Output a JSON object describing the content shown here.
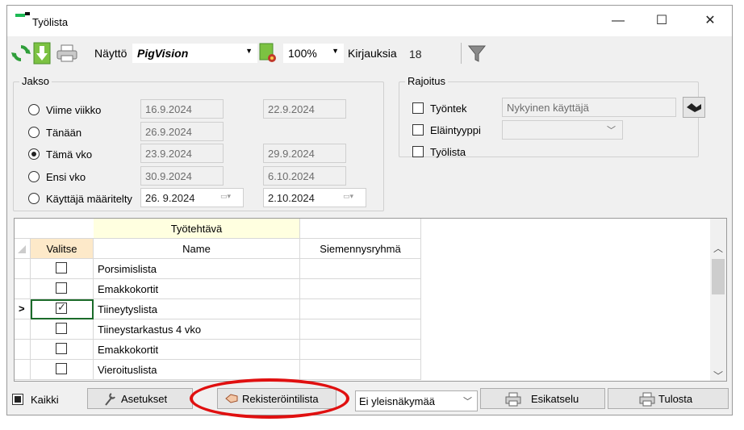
{
  "window": {
    "title": "Työlista",
    "minimize_glyph": "—",
    "maximize_glyph": "☐",
    "close_glyph": "✕"
  },
  "toolbar": {
    "nayto_label": "Näyttö",
    "nayto_value": "PigVision",
    "zoom_value": "100%",
    "kirjauksia_label": "Kirjauksia",
    "kirjauksia_value": "18",
    "icons": [
      "refresh-icon",
      "download-icon",
      "printer-icon",
      "document-settings-icon",
      "filter-icon"
    ]
  },
  "jakso": {
    "title": "Jakso",
    "options": [
      {
        "label": "Viime viikko",
        "from": "16.9.2024",
        "to": "22.9.2024",
        "checked": false
      },
      {
        "label": "Tänään",
        "from": "26.9.2024",
        "to": "",
        "checked": false
      },
      {
        "label": "Tämä vko",
        "from": "23.9.2024",
        "to": "29.9.2024",
        "checked": true
      },
      {
        "label": "Ensi vko",
        "from": "30.9.2024",
        "to": "6.10.2024",
        "checked": false
      },
      {
        "label": "Käyttäjä määritelty",
        "from": "26.  9.2024",
        "to": "2.10.2024",
        "checked": false
      }
    ]
  },
  "rajoitus": {
    "title": "Rajoitus",
    "tyontek_label": "Työntek",
    "tyontek_value": "Nykyinen käyttäjä",
    "elaintyyppi_label": "Eläintyyppi",
    "elaintyyppi_value": "",
    "tyolista_label": "Työlista"
  },
  "grid": {
    "group_header": "Työtehtävä",
    "columns": [
      "Valitse",
      "Name",
      "Siemennysryhmä"
    ],
    "current_row_marker": ">",
    "rows": [
      {
        "name": "Porsimislista",
        "group": "",
        "checked": false
      },
      {
        "name": "Emakkokortit",
        "group": "",
        "checked": false
      },
      {
        "name": "Tiineytyslista",
        "group": "",
        "checked": true
      },
      {
        "name": "Tiineystarkastus 4 vko",
        "group": "",
        "checked": false
      },
      {
        "name": "Emakkokortit",
        "group": "",
        "checked": false
      },
      {
        "name": "Vieroituslista",
        "group": "",
        "checked": false
      }
    ]
  },
  "bottom": {
    "kaikki_label": "Kaikki",
    "asetukset_label": "Asetukset",
    "rekisterointilista_label": "Rekisteröintilista",
    "nakyma_value": "Ei yleisnäkymää",
    "esikatselu_label": "Esikatselu",
    "tulosta_label": "Tulosta"
  },
  "colors": {
    "window_bg": "#f0f0f0",
    "group_header_bg": "#ffffe0",
    "valitse_header_bg": "#fde9c9",
    "highlight_ring": "#e01010"
  }
}
